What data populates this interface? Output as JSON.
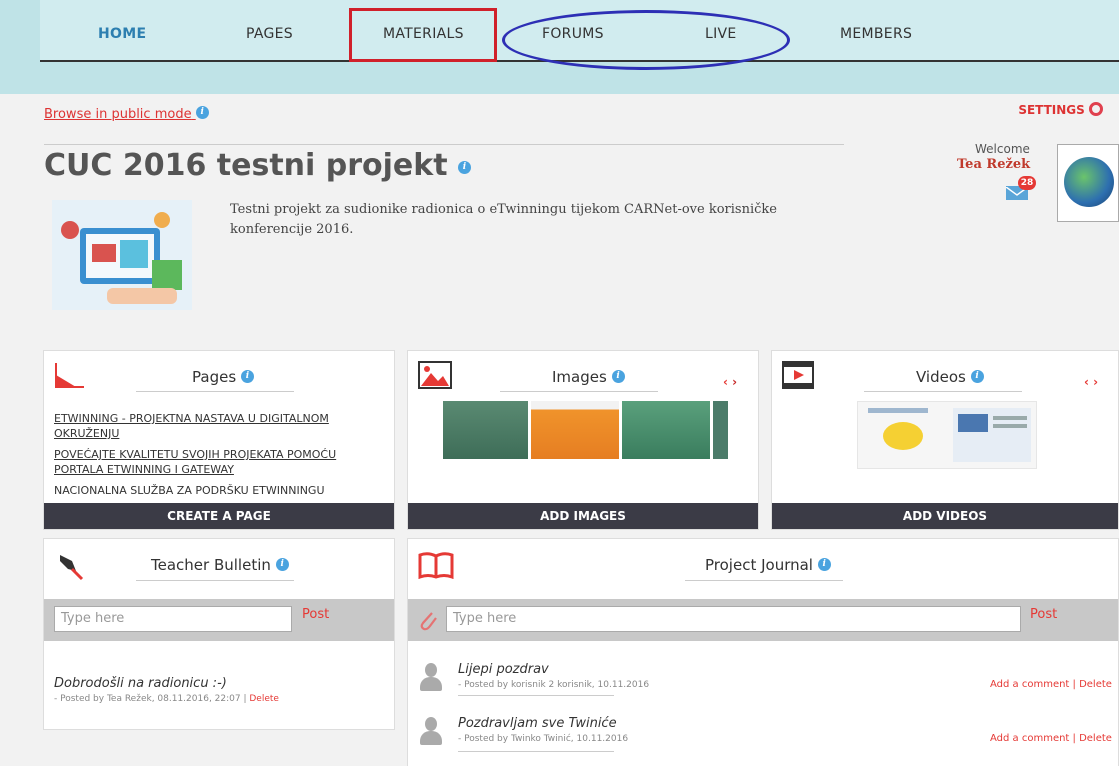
{
  "nav": {
    "items": [
      "HOME",
      "PAGES",
      "MATERIALS",
      "FORUMS",
      "LIVE",
      "MEMBERS"
    ]
  },
  "browse_public": "Browse in public mode",
  "settings_label": "SETTINGS",
  "project": {
    "title": "CUC 2016 testni projekt",
    "description": "Testni projekt za sudionike radionica o eTwinningu tijekom CARNet-ove korisničke konferencije 2016."
  },
  "user": {
    "welcome": "Welcome",
    "name": "Tea Režek",
    "message_count": "28"
  },
  "pages_panel": {
    "title": "Pages",
    "links": [
      "ETWINNING - PROJEKTNA NASTAVA U DIGITALNOM OKRUŽENJU",
      "POVEĆAJTE KVALITETU SVOJIH PROJEKATA POMOĆU PORTALA ETWINNING I GATEWAY",
      "NACIONALNA SLUŽBA ZA PODRŠKU ETWINNINGU"
    ],
    "footer": "CREATE A PAGE"
  },
  "images_panel": {
    "title": "Images",
    "footer": "ADD IMAGES"
  },
  "videos_panel": {
    "title": "Videos",
    "footer": "ADD VIDEOS"
  },
  "bulletin": {
    "title": "Teacher Bulletin",
    "placeholder": "Type here",
    "post_label": "Post",
    "entry_text": "Dobrodošli na radionicu :-)",
    "entry_meta": "- Posted by Tea Režek, 08.11.2016, 22:07 |",
    "delete_label": "Delete"
  },
  "journal": {
    "title": "Project Journal",
    "placeholder": "Type here",
    "post_label": "Post",
    "entries": [
      {
        "text": "Lijepi pozdrav",
        "meta": "- Posted by korisnik 2 korisnik, 10.11.2016",
        "actions": "Add a comment | Delete"
      },
      {
        "text": "Pozdravljam sve Twiniće",
        "meta": "- Posted by Twinko Twinić, 10.11.2016",
        "actions": "Add a comment | Delete"
      }
    ]
  },
  "colors": {
    "accent_red": "#e53935",
    "nav_blue": "#2d7fb0",
    "footer_dark": "#3b3b46",
    "annotation_red": "#d0202a",
    "annotation_blue": "#2d2fb5"
  }
}
